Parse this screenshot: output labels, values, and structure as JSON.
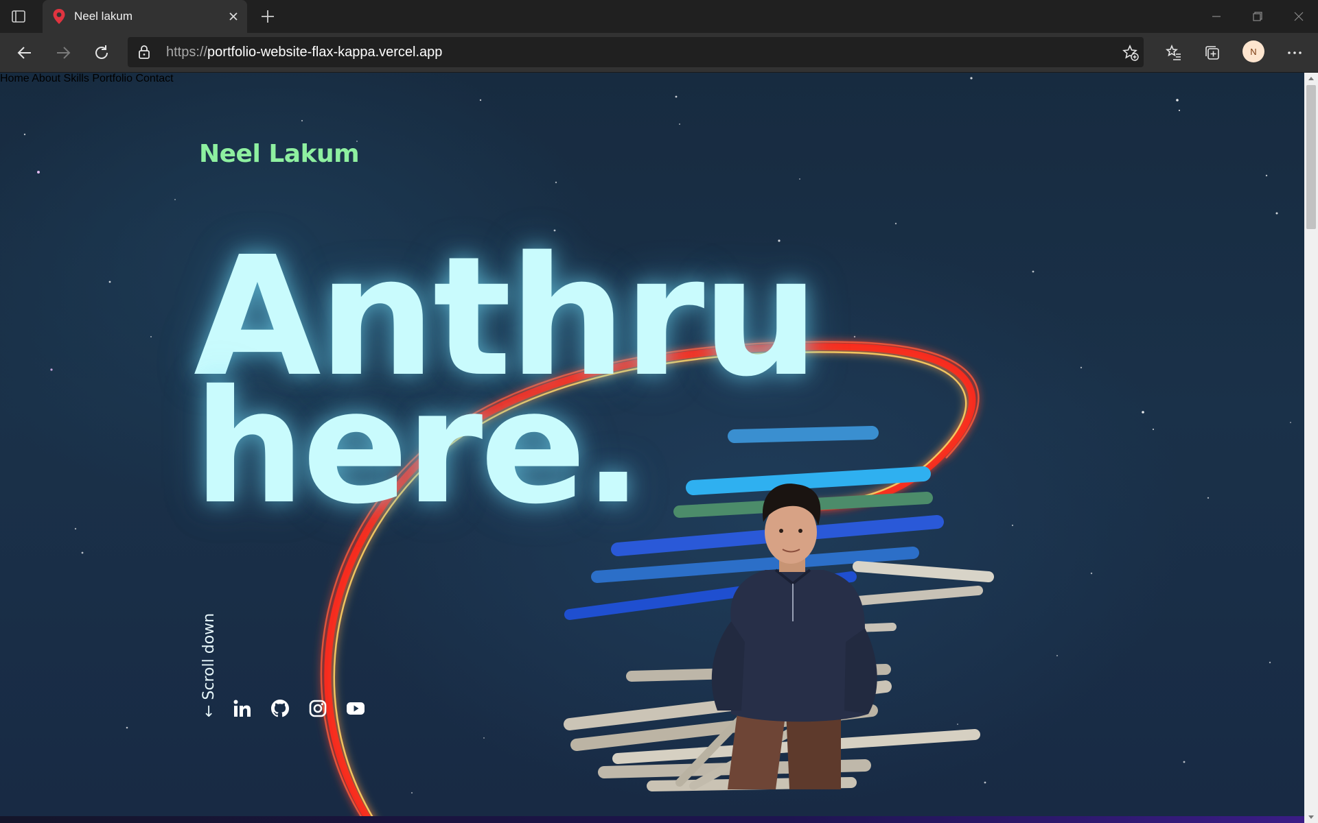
{
  "browser": {
    "tab_title": "Neel lakum",
    "url_scheme": "https://",
    "url_host": "portfolio-website-flax-kappa.vercel.app",
    "profile_initial": "N"
  },
  "site": {
    "logo": "Neel Lakum",
    "nav": [
      "Home",
      "About",
      "Skills",
      "Portfolio",
      "Contact"
    ],
    "hero_line1": "Anthru",
    "hero_line2": "here.",
    "scroll_hint": "← Scroll down",
    "socials": [
      "linkedin-icon",
      "github-icon",
      "instagram-icon",
      "youtube-icon"
    ]
  },
  "colors": {
    "logo": "#8ef0a0",
    "hero_text": "#c9fbfd",
    "background": "#1a3149",
    "ring": "#ff2a1a"
  }
}
